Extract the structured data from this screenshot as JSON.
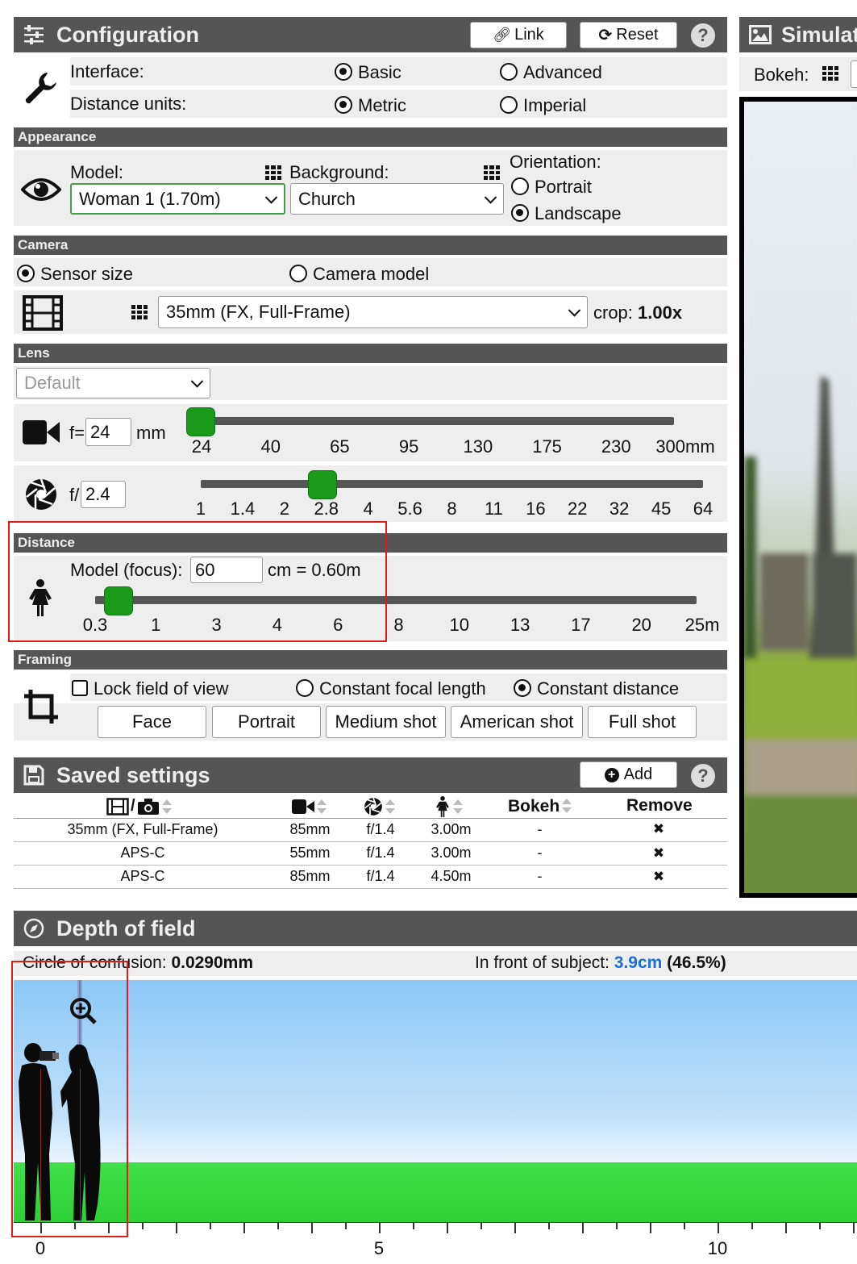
{
  "configuration": {
    "title": "Configuration",
    "link_label": "Link",
    "reset_label": "Reset",
    "help": "?",
    "interface_label": "Interface:",
    "interface_options": [
      "Basic",
      "Advanced"
    ],
    "interface_selected": "Basic",
    "units_label": "Distance units:",
    "units_options": [
      "Metric",
      "Imperial"
    ],
    "units_selected": "Metric"
  },
  "appearance": {
    "title": "Appearance",
    "model_label": "Model:",
    "model_value": "Woman 1 (1.70m)",
    "background_label": "Background:",
    "background_value": "Church",
    "orientation_label": "Orientation:",
    "orientation_options": [
      "Portrait",
      "Landscape"
    ],
    "orientation_selected": "Landscape"
  },
  "camera": {
    "title": "Camera",
    "mode_options": [
      "Sensor size",
      "Camera model"
    ],
    "mode_selected": "Sensor size",
    "sensor_value": "35mm (FX, Full-Frame)",
    "crop_label": "crop:",
    "crop_value": "1.00x"
  },
  "lens": {
    "title": "Lens",
    "preset_value": "Default",
    "focal_prefix": "f=",
    "focal_value": "24",
    "focal_unit": "mm",
    "focal_ticks": [
      "24",
      "40",
      "65",
      "95",
      "130",
      "175",
      "230",
      "300mm"
    ],
    "focal_slider_fraction": 0.0,
    "aperture_prefix": "f/",
    "aperture_value": "2.4",
    "aperture_ticks": [
      "1",
      "1.4",
      "2",
      "2.8",
      "4",
      "5.6",
      "8",
      "11",
      "16",
      "22",
      "32",
      "45",
      "64"
    ],
    "aperture_slider_fraction": 0.22
  },
  "distance": {
    "title": "Distance",
    "focus_label": "Model (focus):",
    "focus_value": "60",
    "focus_suffix": "cm = 0.60m",
    "ticks": [
      "0.3",
      "1",
      "3",
      "4",
      "6",
      "8",
      "10",
      "13",
      "17",
      "20",
      "25m"
    ],
    "slider_fraction": 0.02
  },
  "framing": {
    "title": "Framing",
    "lock_label": "Lock field of view",
    "lock_checked": false,
    "mode_options": [
      "Constant focal length",
      "Constant distance"
    ],
    "mode_selected": "Constant distance",
    "shots": [
      "Face",
      "Portrait",
      "Medium shot",
      "American shot",
      "Full shot"
    ]
  },
  "saved_settings": {
    "title": "Saved settings",
    "add_label": "Add",
    "help": "?",
    "columns": {
      "bokeh": "Bokeh",
      "remove": "Remove"
    },
    "rows": [
      {
        "sensor": "35mm (FX, Full-Frame)",
        "focal": "85mm",
        "aperture": "f/1.4",
        "distance": "3.00m",
        "bokeh": "-",
        "remove": "✖"
      },
      {
        "sensor": "APS-C",
        "focal": "55mm",
        "aperture": "f/1.4",
        "distance": "3.00m",
        "bokeh": "-",
        "remove": "✖"
      },
      {
        "sensor": "APS-C",
        "focal": "85mm",
        "aperture": "f/1.4",
        "distance": "4.50m",
        "bokeh": "-",
        "remove": "✖"
      }
    ]
  },
  "simulation": {
    "title": "Simulat",
    "bokeh_label": "Bokeh:"
  },
  "depth_of_field": {
    "title": "Depth of field",
    "coc_label": "Circle of confusion:",
    "coc_value": "0.0290mm",
    "front_label": "In front of subject:",
    "front_value": "3.9cm",
    "front_percent": "(46.5%)",
    "axis_ticks": [
      "0",
      "5",
      "10"
    ]
  },
  "colors": {
    "header_bg": "#555555",
    "row_bg": "#eeeeee",
    "slider_thumb": "#1a9a1a",
    "highlight_box": "#e01b1b",
    "link_blue": "#1a6fd6"
  }
}
